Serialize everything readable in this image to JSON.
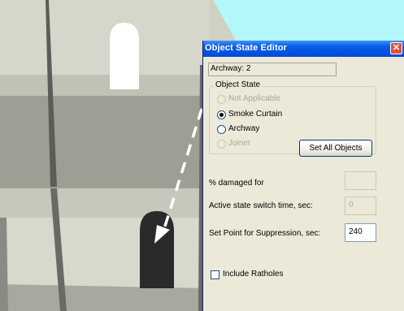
{
  "window": {
    "title": "Object State Editor",
    "close_glyph": "✕",
    "object_name": "Archway: 2"
  },
  "object_state": {
    "group_label": "Object State",
    "options": [
      {
        "label": "Not Applicable",
        "enabled": false,
        "selected": false
      },
      {
        "label": "Smoke Curtain",
        "enabled": true,
        "selected": true
      },
      {
        "label": "Archway",
        "enabled": true,
        "selected": false
      },
      {
        "label": "Joiner",
        "enabled": false,
        "selected": false
      }
    ],
    "set_all_label": "Set All Objects"
  },
  "fields": {
    "damaged_label": "% damaged for",
    "damaged_value": "",
    "switch_label": "Active state switch time, sec:",
    "switch_value": "0",
    "setpoint_label": "Set Point for Suppression, sec:",
    "setpoint_value": "240"
  },
  "ratholes": {
    "label": "Include Ratholes",
    "checked": false
  },
  "colors": {
    "titlebar": "#0054e3",
    "dialog_bg": "#ece9d8",
    "sky": "#b3f7f9",
    "wall_light": "#d8d8cd",
    "wall_shade": "#9f9e95",
    "wall_dark": "#5d5c58",
    "archway_open": "#ffffff",
    "smoke_curtain": "#2a2a2a",
    "annotation_arrow": "#ffffff"
  }
}
